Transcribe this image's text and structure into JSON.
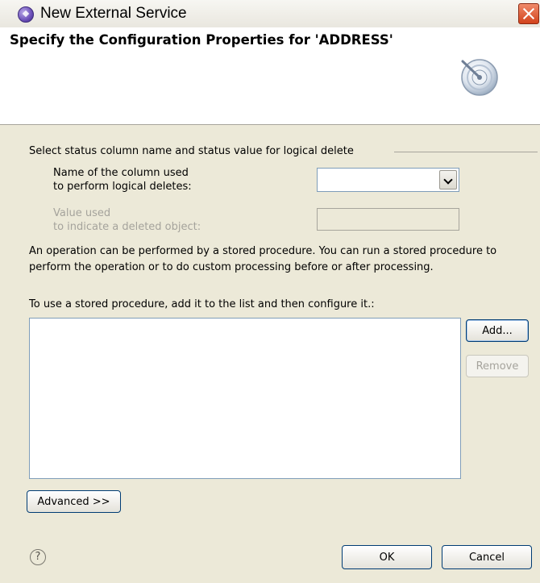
{
  "window": {
    "title": "New External Service",
    "icon": "service-wizard-icon"
  },
  "header": {
    "title": "Specify the Configuration Properties for 'ADDRESS'",
    "icon": "dial-wizard-icon"
  },
  "logical_delete": {
    "group_label": "Select status column name and status value for logical delete",
    "column_label_line1": "Name of the column used",
    "column_label_line2": "to perform logical deletes:",
    "column_value": "",
    "value_label_line1": "Value used",
    "value_label_line2": "to indicate a deleted object:",
    "value_value": ""
  },
  "stored_procedures": {
    "description": "An operation can be performed by a stored procedure. You can run a stored procedure to perform the operation or to do custom processing before or after processing.",
    "list_caption": "To use a stored procedure, add it to the list and then configure it.:",
    "items": [],
    "add_label": "Add...",
    "remove_label": "Remove"
  },
  "buttons": {
    "advanced_label": "Advanced >>",
    "ok_label": "OK",
    "cancel_label": "Cancel",
    "help_glyph": "?"
  }
}
